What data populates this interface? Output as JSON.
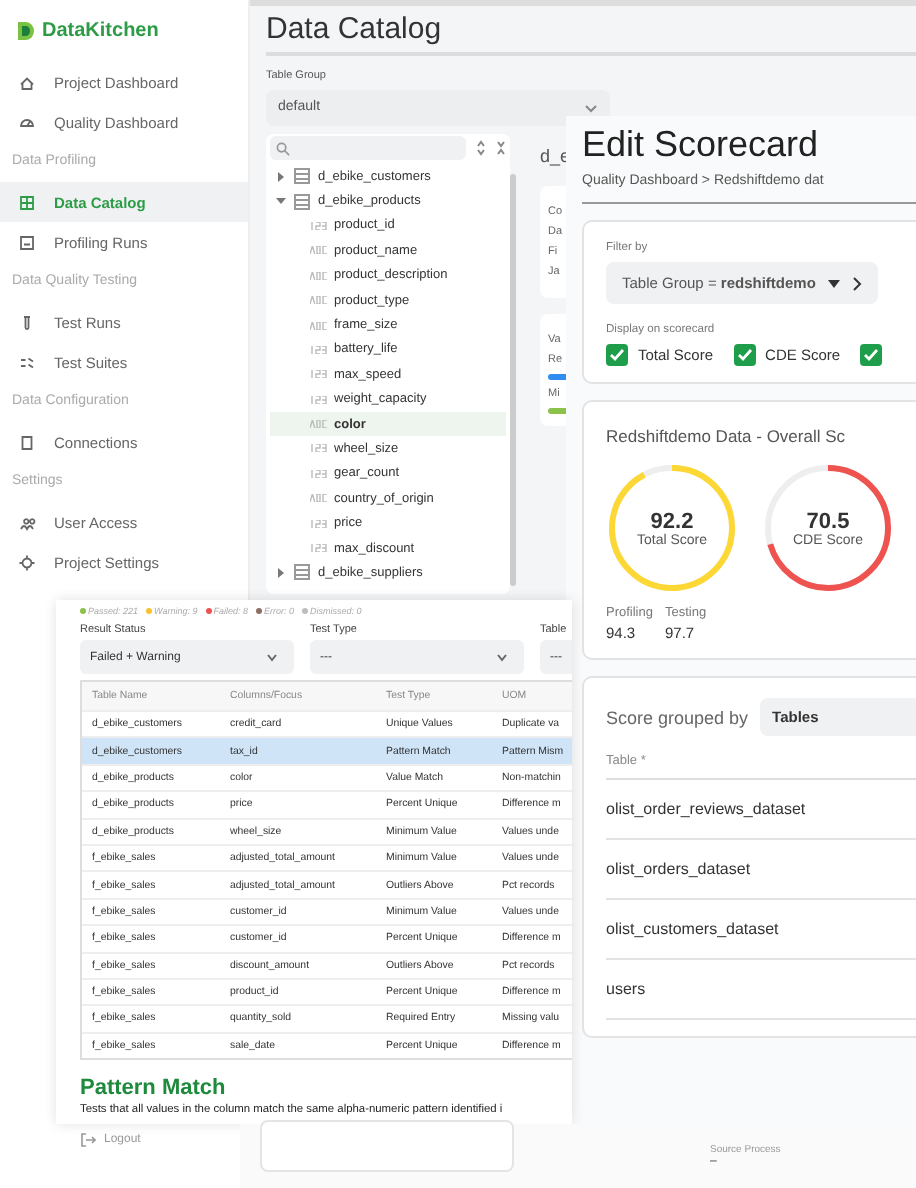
{
  "brand": "DataKitchen",
  "sidebar": [
    {
      "kind": "item",
      "label": "Project Dashboard",
      "selected": false
    },
    {
      "kind": "item",
      "label": "Quality Dashboard",
      "selected": false
    },
    {
      "kind": "section",
      "label": "Data Profiling"
    },
    {
      "kind": "item",
      "label": "Data Catalog",
      "selected": true
    },
    {
      "kind": "item",
      "label": "Profiling Runs",
      "selected": false
    },
    {
      "kind": "section",
      "label": "Data Quality Testing"
    },
    {
      "kind": "item",
      "label": "Test Runs",
      "selected": false
    },
    {
      "kind": "item",
      "label": "Test Suites",
      "selected": false
    },
    {
      "kind": "section",
      "label": "Data Configuration"
    },
    {
      "kind": "item",
      "label": "Connections",
      "selected": false
    },
    {
      "kind": "section",
      "label": "Settings"
    },
    {
      "kind": "item",
      "label": "User Access",
      "selected": false
    },
    {
      "kind": "item",
      "label": "Project Settings",
      "selected": false
    }
  ],
  "logout": "Logout",
  "catalog": {
    "title": "Data Catalog",
    "table_group_label": "Table Group",
    "table_group": "default",
    "tree": [
      {
        "label": "d_ebike_customers",
        "expanded": false
      },
      {
        "label": "d_ebike_products",
        "expanded": true,
        "children": [
          {
            "label": "product_id",
            "kind": "number",
            "selected": false
          },
          {
            "label": "product_name",
            "kind": "text",
            "selected": false
          },
          {
            "label": "product_description",
            "kind": "text",
            "selected": false
          },
          {
            "label": "product_type",
            "kind": "text",
            "selected": false
          },
          {
            "label": "frame_size",
            "kind": "text",
            "selected": false
          },
          {
            "label": "battery_life",
            "kind": "number",
            "selected": false
          },
          {
            "label": "max_speed",
            "kind": "number",
            "selected": false
          },
          {
            "label": "weight_capacity",
            "kind": "number",
            "selected": false
          },
          {
            "label": "color",
            "kind": "text",
            "selected": true
          },
          {
            "label": "wheel_size",
            "kind": "number",
            "selected": false
          },
          {
            "label": "gear_count",
            "kind": "number",
            "selected": false
          },
          {
            "label": "country_of_origin",
            "kind": "text",
            "selected": false
          },
          {
            "label": "price",
            "kind": "number",
            "selected": false
          },
          {
            "label": "max_discount",
            "kind": "number",
            "selected": false
          }
        ]
      },
      {
        "label": "d_ebike_suppliers",
        "expanded": false
      }
    ],
    "detail_title": "d_e",
    "card_1": [
      "Co",
      "Da",
      "Fi",
      "Ja"
    ],
    "card_2": {
      "title": "Va",
      "bars": [
        {
          "label": "Re",
          "color": "#2f8cf0"
        },
        {
          "label": "Mi",
          "color": "#8bc34a"
        }
      ]
    }
  },
  "scorecard": {
    "title": "Edit Scorecard",
    "breadcrumb": "Quality Dashboard > Redshiftdemo dat",
    "filter_label": "Filter by",
    "filter": "Table Group = **redshiftdemo**",
    "display_label": "Display on scorecard",
    "checkboxes": [
      {
        "label": "Total Score",
        "checked": true
      },
      {
        "label": "CDE Score",
        "checked": true
      },
      {
        "checked": true
      }
    ],
    "overall_title": "Redshiftdemo Data - Overall Sc",
    "scores": [
      {
        "value": "92.2",
        "label": "Total Score",
        "level": 0.922,
        "color": "#fdd835"
      },
      {
        "value": "70.5",
        "label": "CDE Score",
        "level": 0.705,
        "color": "#ef5350"
      }
    ],
    "sub_scores": [
      {
        "label": "Profiling",
        "value": "94.3"
      },
      {
        "label": "Testing",
        "value": "97.7"
      }
    ],
    "group_label": "Score grouped by",
    "group_value": "Tables",
    "table_header": "Table *",
    "tables": [
      "olist_order_reviews_dataset",
      "olist_orders_dataset",
      "olist_customers_dataset",
      "users"
    ]
  },
  "tests": {
    "legend": [
      {
        "label": "Passed: 221",
        "color": "#8bc34a"
      },
      {
        "label": "Warning: 9",
        "color": "#fbc02d"
      },
      {
        "label": "Failed: 8",
        "color": "#ef5350"
      },
      {
        "label": "Error: 0",
        "color": "#8d6e63"
      },
      {
        "label": "Dismissed: 0",
        "color": "#bdbdbd"
      }
    ],
    "filters": [
      {
        "label": "Result Status",
        "value": "Failed + Warning"
      },
      {
        "label": "Test Type",
        "value": "---"
      },
      {
        "label": "Table",
        "value": "---"
      }
    ],
    "columns": [
      "Table Name",
      "Columns/Focus",
      "Test Type",
      "UOM"
    ],
    "rows": [
      {
        "cells": [
          "d_ebike_customers",
          "credit_card",
          "Unique Values",
          "Duplicate va"
        ],
        "selected": false
      },
      {
        "cells": [
          "d_ebike_customers",
          "tax_id",
          "Pattern Match",
          "Pattern Mism"
        ],
        "selected": true
      },
      {
        "cells": [
          "d_ebike_products",
          "color",
          "Value Match",
          "Non-matchin"
        ],
        "selected": false
      },
      {
        "cells": [
          "d_ebike_products",
          "price",
          "Percent Unique",
          "Difference m"
        ],
        "selected": false
      },
      {
        "cells": [
          "d_ebike_products",
          "wheel_size",
          "Minimum Value",
          "Values unde"
        ],
        "selected": false
      },
      {
        "cells": [
          "f_ebike_sales",
          "adjusted_total_amount",
          "Minimum Value",
          "Values unde"
        ],
        "selected": false
      },
      {
        "cells": [
          "f_ebike_sales",
          "adjusted_total_amount",
          "Outliers Above",
          "Pct records"
        ],
        "selected": false
      },
      {
        "cells": [
          "f_ebike_sales",
          "customer_id",
          "Minimum Value",
          "Values unde"
        ],
        "selected": false
      },
      {
        "cells": [
          "f_ebike_sales",
          "customer_id",
          "Percent Unique",
          "Difference m"
        ],
        "selected": false
      },
      {
        "cells": [
          "f_ebike_sales",
          "discount_amount",
          "Outliers Above",
          "Pct records"
        ],
        "selected": false
      },
      {
        "cells": [
          "f_ebike_sales",
          "product_id",
          "Percent Unique",
          "Difference m"
        ],
        "selected": false
      },
      {
        "cells": [
          "f_ebike_sales",
          "quantity_sold",
          "Required Entry",
          "Missing valu"
        ],
        "selected": false
      },
      {
        "cells": [
          "f_ebike_sales",
          "sale_date",
          "Percent Unique",
          "Difference m"
        ],
        "selected": false
      }
    ],
    "detail_title": "Pattern Match",
    "detail_text": "Tests that all values in the column match the same alpha-numeric pattern identified i"
  },
  "bottom": {
    "label": "Source Process",
    "value": "–"
  }
}
